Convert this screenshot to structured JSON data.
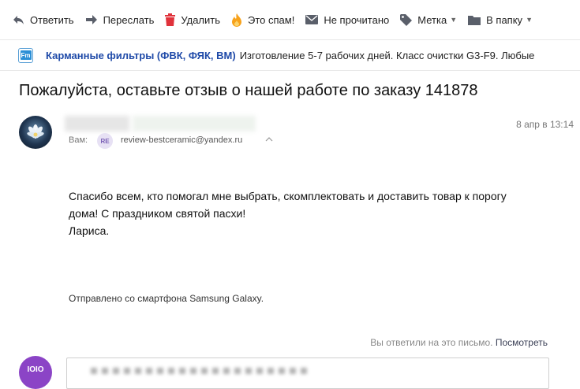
{
  "toolbar": {
    "reply": "Ответить",
    "forward": "Переслать",
    "delete": "Удалить",
    "spam": "Это спам!",
    "unread": "Не прочитано",
    "label": "Метка",
    "to_folder": "В папку"
  },
  "promo": {
    "logo_text": "Fm",
    "sender": "Карманные фильтры (ФВК, ФЯК, ВМ)",
    "text": "Изготовление 5-7 рабочих дней. Класс очистки G3-F9. Любые"
  },
  "message": {
    "subject": "Пожалуйста, оставьте отзыв о нашей работе по заказу 141878",
    "to_label": "Вам:",
    "to_badge": "RE",
    "to_email": "review-bestceramic@yandex.ru",
    "date": "8 апр в 13:14",
    "body_lines": [
      "Спасибо всем, кто помогал мне выбрать, скомплектовать и доставить товар к порогу",
      "дома! С праздником святой пасхи!",
      "Лариса."
    ],
    "signature": "Отправлено со смартфона Samsung Galaxy."
  },
  "footer": {
    "replied_text": "Вы ответили на это письмо.",
    "view_link": "Посмотреть",
    "my_avatar_text": "IOIO"
  },
  "colors": {
    "link": "#1f4aa8",
    "spam_flame": "#f7a21b",
    "delete_red": "#e0323b",
    "my_avatar": "#8b44c6"
  }
}
